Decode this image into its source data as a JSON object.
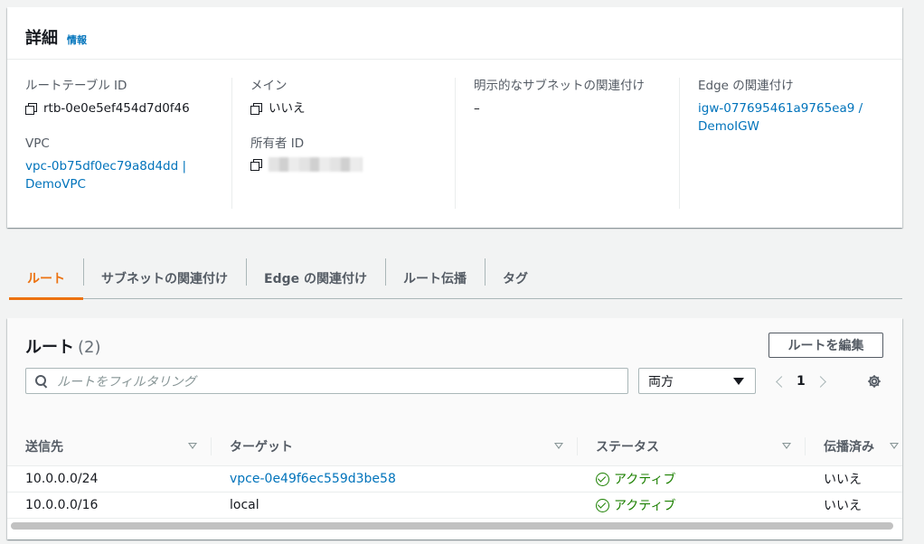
{
  "details": {
    "title": "詳細",
    "info_link": "情報",
    "route_table_id_label": "ルートテーブル ID",
    "route_table_id": "rtb-0e0e5ef454d7d0f46",
    "vpc_label": "VPC",
    "vpc_value": "vpc-0b75df0ec79a8d4dd | DemoVPC",
    "vpc_line1": "vpc-0b75df0ec79a8d4dd |",
    "vpc_line2": "DemoVPC",
    "main_label": "メイン",
    "main_value": "いいえ",
    "owner_label": "所有者 ID",
    "explicit_subnet_label": "明示的なサブネットの関連付け",
    "explicit_subnet_value": "–",
    "edge_label": "Edge の関連付け",
    "edge_line1": "igw-077695461a9765ea9 /",
    "edge_line2": "DemoIGW"
  },
  "tabs": [
    {
      "label": "ルート",
      "active": true
    },
    {
      "label": "サブネットの関連付け",
      "active": false
    },
    {
      "label": "Edge の関連付け",
      "active": false
    },
    {
      "label": "ルート伝播",
      "active": false
    },
    {
      "label": "タグ",
      "active": false
    }
  ],
  "routes": {
    "title": "ルート",
    "count": "(2)",
    "edit_button": "ルートを編集",
    "search_placeholder": "ルートをフィルタリング",
    "filter_select": "両方",
    "page": "1",
    "columns": [
      "送信先",
      "ターゲット",
      "ステータス",
      "伝播済み"
    ],
    "rows": [
      {
        "destination": "10.0.0.0/24",
        "target": "vpce-0e49f6ec559d3be58",
        "target_is_link": true,
        "status": "アクティブ",
        "propagated": "いいえ"
      },
      {
        "destination": "10.0.0.0/16",
        "target": "local",
        "target_is_link": false,
        "status": "アクティブ",
        "propagated": "いいえ"
      }
    ]
  },
  "colors": {
    "accent": "#ec7211",
    "link": "#0073bb",
    "success": "#1d8102"
  }
}
